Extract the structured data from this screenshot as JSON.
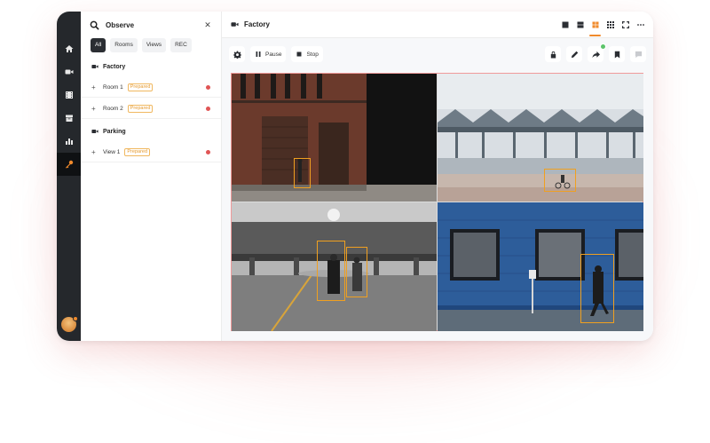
{
  "sidebar_rail": {
    "items": [
      "home-icon",
      "video-icon",
      "film-icon",
      "archive-icon",
      "chart-icon",
      "key-icon"
    ],
    "active": "key-icon"
  },
  "panel": {
    "title": "Observe",
    "filters": [
      "All",
      "Rooms",
      "Views",
      "REC"
    ],
    "active_filter": "All",
    "groups": [
      {
        "label": "Factory",
        "rooms": [
          {
            "name": "Room 1",
            "tag": "Prepared"
          },
          {
            "name": "Room 2",
            "tag": "Prepared"
          }
        ]
      },
      {
        "label": "Parking",
        "rooms": [
          {
            "name": "View 1",
            "tag": "Prepared"
          }
        ]
      }
    ]
  },
  "main": {
    "title": "Factory",
    "toolbar": {
      "pause_label": "Pause",
      "stop_label": "Stop"
    },
    "layout_options": [
      "single-view-icon",
      "split-view-icon",
      "grid-2x2-icon",
      "grid-3x3-icon",
      "fullscreen-icon",
      "more-icon"
    ],
    "active_layout": "grid-2x2-icon"
  },
  "colors": {
    "accent": "#f08a2c",
    "live": "#e05555",
    "detection": "#f0a020",
    "rail": "#25282c"
  },
  "cameras": [
    "factory-brick-building",
    "station-canopy",
    "parking-garage",
    "blue-wall-street"
  ]
}
